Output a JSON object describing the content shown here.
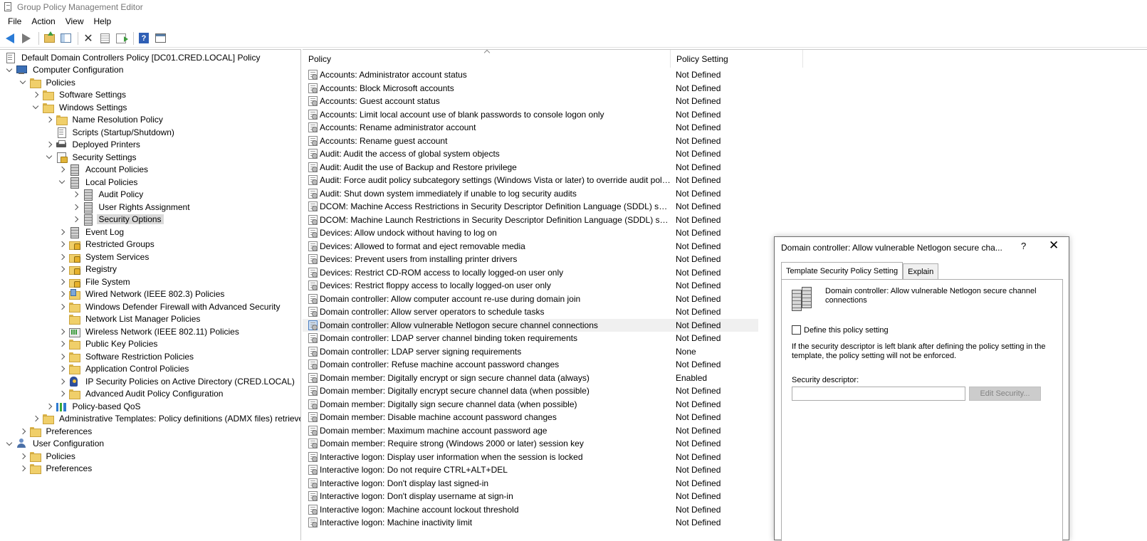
{
  "window": {
    "title": "Group Policy Management Editor"
  },
  "menu": [
    "File",
    "Action",
    "View",
    "Help"
  ],
  "toolbar": [
    "back-icon",
    "forward-icon",
    "up-folder-icon",
    "show-hide-tree-icon",
    "delete-icon",
    "properties-icon",
    "export-list-icon",
    "help-icon",
    "console-icon"
  ],
  "tree": [
    {
      "label": "Default Domain Controllers Policy [DC01.CRED.LOCAL] Policy",
      "icon": "doc",
      "level": 0,
      "exp": "",
      "name": "tree-root-policy"
    },
    {
      "label": "Computer Configuration",
      "icon": "computer",
      "level": 0,
      "exp": "down",
      "name": "tree-computer-configuration"
    },
    {
      "label": "Policies",
      "icon": "folder",
      "level": 1,
      "exp": "down",
      "name": "tree-policies"
    },
    {
      "label": "Software Settings",
      "icon": "folder",
      "level": 2,
      "exp": "right",
      "name": "tree-software-settings"
    },
    {
      "label": "Windows Settings",
      "icon": "folder",
      "level": 2,
      "exp": "down",
      "name": "tree-windows-settings"
    },
    {
      "label": "Name Resolution Policy",
      "icon": "folder",
      "level": 3,
      "exp": "right",
      "name": "tree-name-resolution-policy"
    },
    {
      "label": "Scripts (Startup/Shutdown)",
      "icon": "doc",
      "level": 3,
      "exp": "",
      "name": "tree-scripts"
    },
    {
      "label": "Deployed Printers",
      "icon": "printer",
      "level": 3,
      "exp": "right",
      "name": "tree-deployed-printers"
    },
    {
      "label": "Security Settings",
      "icon": "security",
      "level": 3,
      "exp": "down",
      "name": "tree-security-settings"
    },
    {
      "label": "Account Policies",
      "icon": "server",
      "level": 4,
      "exp": "right",
      "name": "tree-account-policies"
    },
    {
      "label": "Local Policies",
      "icon": "server",
      "level": 4,
      "exp": "down",
      "name": "tree-local-policies"
    },
    {
      "label": "Audit Policy",
      "icon": "server",
      "level": 5,
      "exp": "right",
      "name": "tree-audit-policy"
    },
    {
      "label": "User Rights Assignment",
      "icon": "server",
      "level": 5,
      "exp": "right",
      "name": "tree-user-rights-assignment"
    },
    {
      "label": "Security Options",
      "icon": "server",
      "level": 5,
      "exp": "right",
      "name": "tree-security-options",
      "selected": true
    },
    {
      "label": "Event Log",
      "icon": "server",
      "level": 4,
      "exp": "right",
      "name": "tree-event-log"
    },
    {
      "label": "Restricted Groups",
      "icon": "lockfolder",
      "level": 4,
      "exp": "right",
      "name": "tree-restricted-groups"
    },
    {
      "label": "System Services",
      "icon": "lockfolder",
      "level": 4,
      "exp": "right",
      "name": "tree-system-services"
    },
    {
      "label": "Registry",
      "icon": "lockfolder",
      "level": 4,
      "exp": "right",
      "name": "tree-registry"
    },
    {
      "label": "File System",
      "icon": "lockfolder",
      "level": 4,
      "exp": "right",
      "name": "tree-file-system"
    },
    {
      "label": "Wired Network (IEEE 802.3) Policies",
      "icon": "network",
      "level": 4,
      "exp": "right",
      "name": "tree-wired-network"
    },
    {
      "label": "Windows Defender Firewall with Advanced Security",
      "icon": "folder",
      "level": 4,
      "exp": "right",
      "name": "tree-windows-defender-firewall"
    },
    {
      "label": "Network List Manager Policies",
      "icon": "folder",
      "level": 4,
      "exp": "",
      "name": "tree-network-list-manager"
    },
    {
      "label": "Wireless Network (IEEE 802.11) Policies",
      "icon": "wireless",
      "level": 4,
      "exp": "right",
      "name": "tree-wireless-network"
    },
    {
      "label": "Public Key Policies",
      "icon": "folder",
      "level": 4,
      "exp": "right",
      "name": "tree-public-key-policies"
    },
    {
      "label": "Software Restriction Policies",
      "icon": "folder",
      "level": 4,
      "exp": "right",
      "name": "tree-software-restriction-policies"
    },
    {
      "label": "Application Control Policies",
      "icon": "folder",
      "level": 4,
      "exp": "right",
      "name": "tree-application-control-policies"
    },
    {
      "label": "IP Security Policies on Active Directory (CRED.LOCAL)",
      "icon": "ipsec",
      "level": 4,
      "exp": "right",
      "name": "tree-ip-security-policies"
    },
    {
      "label": "Advanced Audit Policy Configuration",
      "icon": "folder",
      "level": 4,
      "exp": "right",
      "name": "tree-advanced-audit-policy"
    },
    {
      "label": "Policy-based QoS",
      "icon": "qos",
      "level": 3,
      "exp": "right",
      "name": "tree-policy-based-qos"
    },
    {
      "label": "Administrative Templates: Policy definitions (ADMX files) retrieved",
      "icon": "folder",
      "level": 2,
      "exp": "right",
      "name": "tree-administrative-templates"
    },
    {
      "label": "Preferences",
      "icon": "folder",
      "level": 1,
      "exp": "right",
      "name": "tree-preferences-computer"
    },
    {
      "label": "User Configuration",
      "icon": "user",
      "level": 0,
      "exp": "down",
      "name": "tree-user-configuration"
    },
    {
      "label": "Policies",
      "icon": "folder",
      "level": 1,
      "exp": "right",
      "name": "tree-user-policies"
    },
    {
      "label": "Preferences",
      "icon": "folder",
      "level": 1,
      "exp": "right",
      "name": "tree-user-preferences"
    }
  ],
  "list": {
    "columns": {
      "policy": "Policy",
      "setting": "Policy Setting"
    },
    "rows": [
      {
        "policy": "Accounts: Administrator account status",
        "setting": "Not Defined"
      },
      {
        "policy": "Accounts: Block Microsoft accounts",
        "setting": "Not Defined"
      },
      {
        "policy": "Accounts: Guest account status",
        "setting": "Not Defined"
      },
      {
        "policy": "Accounts: Limit local account use of blank passwords to console logon only",
        "setting": "Not Defined"
      },
      {
        "policy": "Accounts: Rename administrator account",
        "setting": "Not Defined"
      },
      {
        "policy": "Accounts: Rename guest account",
        "setting": "Not Defined"
      },
      {
        "policy": "Audit: Audit the access of global system objects",
        "setting": "Not Defined"
      },
      {
        "policy": "Audit: Audit the use of Backup and Restore privilege",
        "setting": "Not Defined"
      },
      {
        "policy": "Audit: Force audit policy subcategory settings (Windows Vista or later) to override audit policy ...",
        "setting": "Not Defined"
      },
      {
        "policy": "Audit: Shut down system immediately if unable to log security audits",
        "setting": "Not Defined"
      },
      {
        "policy": "DCOM: Machine Access Restrictions in Security Descriptor Definition Language (SDDL) syntax",
        "setting": "Not Defined"
      },
      {
        "policy": "DCOM: Machine Launch Restrictions in Security Descriptor Definition Language (SDDL) syntax",
        "setting": "Not Defined"
      },
      {
        "policy": "Devices: Allow undock without having to log on",
        "setting": "Not Defined"
      },
      {
        "policy": "Devices: Allowed to format and eject removable media",
        "setting": "Not Defined"
      },
      {
        "policy": "Devices: Prevent users from installing printer drivers",
        "setting": "Not Defined"
      },
      {
        "policy": "Devices: Restrict CD-ROM access to locally logged-on user only",
        "setting": "Not Defined"
      },
      {
        "policy": "Devices: Restrict floppy access to locally logged-on user only",
        "setting": "Not Defined"
      },
      {
        "policy": "Domain controller: Allow computer account re-use during domain join",
        "setting": "Not Defined"
      },
      {
        "policy": "Domain controller: Allow server operators to schedule tasks",
        "setting": "Not Defined"
      },
      {
        "policy": "Domain controller: Allow vulnerable Netlogon secure channel connections",
        "setting": "Not Defined",
        "selected": true
      },
      {
        "policy": "Domain controller: LDAP server channel binding token requirements",
        "setting": "Not Defined"
      },
      {
        "policy": "Domain controller: LDAP server signing requirements",
        "setting": "None"
      },
      {
        "policy": "Domain controller: Refuse machine account password changes",
        "setting": "Not Defined"
      },
      {
        "policy": "Domain member: Digitally encrypt or sign secure channel data (always)",
        "setting": "Enabled"
      },
      {
        "policy": "Domain member: Digitally encrypt secure channel data (when possible)",
        "setting": "Not Defined"
      },
      {
        "policy": "Domain member: Digitally sign secure channel data (when possible)",
        "setting": "Not Defined"
      },
      {
        "policy": "Domain member: Disable machine account password changes",
        "setting": "Not Defined"
      },
      {
        "policy": "Domain member: Maximum machine account password age",
        "setting": "Not Defined"
      },
      {
        "policy": "Domain member: Require strong (Windows 2000 or later) session key",
        "setting": "Not Defined"
      },
      {
        "policy": "Interactive logon: Display user information when the session is locked",
        "setting": "Not Defined"
      },
      {
        "policy": "Interactive logon: Do not require CTRL+ALT+DEL",
        "setting": "Not Defined"
      },
      {
        "policy": "Interactive logon: Don't display last signed-in",
        "setting": "Not Defined"
      },
      {
        "policy": "Interactive logon: Don't display username at sign-in",
        "setting": "Not Defined"
      },
      {
        "policy": "Interactive logon: Machine account lockout threshold",
        "setting": "Not Defined"
      },
      {
        "policy": "Interactive logon: Machine inactivity limit",
        "setting": "Not Defined"
      }
    ]
  },
  "dialog": {
    "title": "Domain controller: Allow vulnerable Netlogon secure cha...",
    "help": "?",
    "close": "✕",
    "tabs": [
      "Template Security Policy Setting",
      "Explain"
    ],
    "policy_name": "Domain controller: Allow vulnerable Netlogon secure channel connections",
    "define_label": "Define this policy setting",
    "define_checked": false,
    "note": "If the security descriptor is left blank after defining the policy setting in the template, the policy setting will not be enforced.",
    "sd_label": "Security descriptor:",
    "sd_value": "",
    "edit_button": "Edit Security..."
  }
}
